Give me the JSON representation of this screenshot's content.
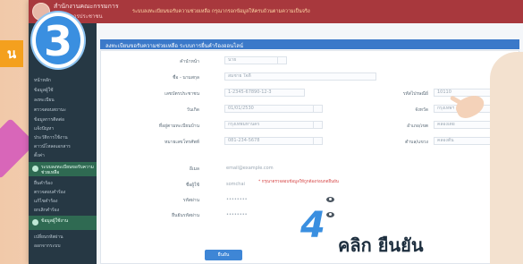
{
  "overlay": {
    "left_tab_label": "น",
    "step3_number": "3",
    "step4_number": "4",
    "step4_text": "คลิก ยืนยัน"
  },
  "header": {
    "title": "สำนักงานคณะกรรมการ",
    "subtitle": "ศูนย์บริการประชาชน",
    "notice": "ระบบลงทะเบียนขอรับความช่วยเหลือ กรุณากรอกข้อมูลให้ครบถ้วนตามความเป็นจริง"
  },
  "sidebar": {
    "items_top": [
      "หน้าหลัก",
      "ข้อมูลผู้ใช้",
      "ลงทะเบียน",
      "ตรวจสอบสถานะ",
      "ข้อมูลการติดต่อ",
      "แจ้งปัญหา",
      "ประวัติการใช้งาน",
      "ดาวน์โหลดเอกสาร",
      "ตั้งค่า"
    ],
    "section1": "ระบบลงทะเบียนขอรับความช่วยเหลือ",
    "items_mid": [
      "ยื่นคำร้อง",
      "ตรวจสอบคำร้อง",
      "แก้ไขคำร้อง",
      "ยกเลิกคำร้อง"
    ],
    "section2": "ข้อมูลผู้ใช้งาน",
    "items_bottom": [
      "เปลี่ยนรหัสผ่าน",
      "ออกจากระบบ"
    ]
  },
  "panel": {
    "title": "ลงทะเบียนขอรับความช่วยเหลือ ระบบการยื่นคำร้องออนไลน์"
  },
  "form": {
    "rows": [
      {
        "label": "คำนำหน้า",
        "value": "นาย"
      },
      {
        "label": "ชื่อ - นามสกุล",
        "value": "สมชาย ใจดี"
      },
      {
        "label": "เลขบัตรประชาชน",
        "value": "1-2345-67890-12-3"
      },
      {
        "label": "วันเกิด",
        "value": "01/01/2530"
      },
      {
        "label": "ที่อยู่ตามทะเบียนบ้าน",
        "value": "กรุงเทพมหานคร"
      },
      {
        "label": "หมายเลขโทรศัพท์",
        "value": "081-234-5678"
      },
      {
        "label": "อีเมล",
        "value": "email@example.com"
      },
      {
        "label": "ชื่อผู้ใช้",
        "value": "somchai"
      },
      {
        "label": "รหัสผ่าน",
        "value": "••••••••"
      },
      {
        "label": "ยืนยันรหัสผ่าน",
        "value": "••••••••"
      }
    ],
    "right_rows": [
      {
        "label": "รหัสไปรษณีย์",
        "value": "10110"
      },
      {
        "label": "จังหวัด",
        "value": "กรุงเทพฯ"
      },
      {
        "label": "อำเภอ/เขต",
        "value": "คลองเตย"
      },
      {
        "label": "ตำบล/แขวง",
        "value": "คลองตัน"
      }
    ],
    "red_note": "* กรุณาตรวจสอบข้อมูลให้ถูกต้องก่อนกดยืนยัน",
    "confirm_label": "ยืนยัน"
  }
}
